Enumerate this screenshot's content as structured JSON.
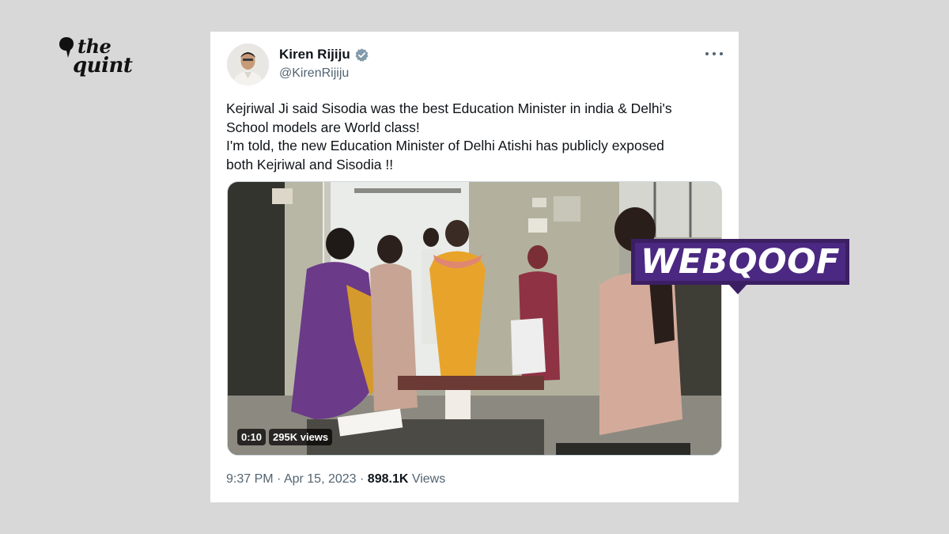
{
  "brand": {
    "logo_line1": "the",
    "logo_line2": "quint"
  },
  "tweet": {
    "author_name": "Kiren Rijiju",
    "author_handle": "@KirenRijiju",
    "verified": true,
    "text_lines": [
      "Kejriwal Ji said Sisodia was the best Education Minister in india & Delhi's",
      "School models are World class!",
      "I'm told, the new Education Minister of Delhi Atishi has publicly exposed",
      "both Kejriwal and Sisodia !!"
    ],
    "video": {
      "duration": "0:10",
      "views_badge": "295K views"
    },
    "time": "9:37 PM",
    "separator": "·",
    "date": "Apr 15, 2023",
    "views_count": "898.1K",
    "views_label": "Views"
  },
  "label": {
    "text": "WEBQOOF"
  },
  "colors": {
    "background": "#d8d8d8",
    "card": "#ffffff",
    "text_primary": "#0f1419",
    "text_secondary": "#536471",
    "verified_badge": "#829aab",
    "webqoof_purple": "#4b2881"
  },
  "icons": [
    "quote-mark-logo-icon",
    "verified-badge-icon",
    "more-options-icon"
  ]
}
